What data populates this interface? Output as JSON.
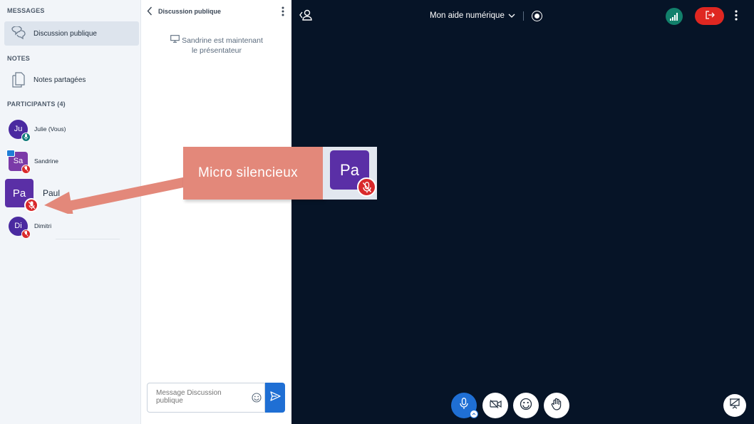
{
  "sidebar": {
    "messages_title": "MESSAGES",
    "public_chat_label": "Discussion publique",
    "notes_title": "NOTES",
    "shared_notes_label": "Notes partagées",
    "participants_title": "PARTICIPANTS (4)",
    "participants": [
      {
        "initials": "Ju",
        "name": "Julie (Vous)",
        "color": "#4a2aa0",
        "mic": "on"
      },
      {
        "initials": "Sa",
        "name": "Sandrine",
        "color": "#7b3aa8",
        "mic": "muted",
        "presenter": true
      },
      {
        "initials": "Pa",
        "name": "Paul",
        "color": "#5a2fa6",
        "mic": "muted"
      },
      {
        "initials": "Di",
        "name": "Dimitri",
        "color": "#4a2aa0",
        "mic": "muted"
      }
    ]
  },
  "chat": {
    "title": "Discussion publique",
    "system_message_line1": "Sandrine est maintenant",
    "system_message_line2": "le présentateur",
    "input_placeholder": "Message Discussion publique"
  },
  "main": {
    "meeting_title": "Mon aide numérique"
  },
  "callout": {
    "text": "Micro silencieux",
    "zoom_initials": "Pa"
  },
  "colors": {
    "accent_blue": "#1f6fd4",
    "leave_red": "#df2721",
    "muted_red": "#d9292b",
    "connection_green": "#12806b",
    "main_bg": "#061427",
    "callout": "#e3887a"
  },
  "icons": {
    "public_chat": "chat-bubbles-icon",
    "notes": "document-icon",
    "back": "chevron-left-icon",
    "menu": "vertical-dots-icon",
    "presentation": "presentation-screen-icon",
    "emoji": "smiley-icon",
    "send": "send-arrow-icon",
    "userlist": "user-toggle-icon",
    "record": "record-icon",
    "connection": "signal-bars-icon",
    "leave": "exit-icon",
    "microphone": "microphone-icon",
    "camera_off": "camera-off-icon",
    "reactions": "smiley-icon",
    "raise_hand": "hand-icon",
    "mic_muted": "microphone-off-icon"
  }
}
